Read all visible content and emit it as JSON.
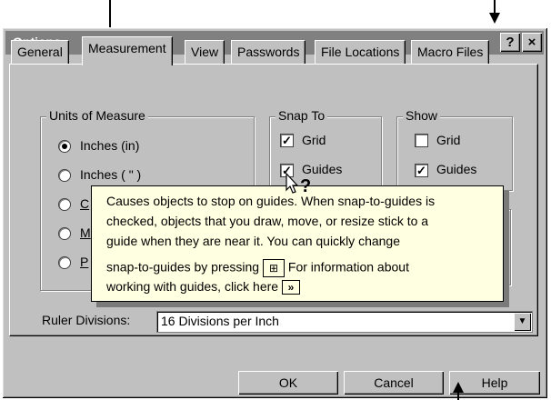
{
  "window": {
    "title": "Options",
    "help_btn": "?",
    "close_btn": "×"
  },
  "tabs": [
    {
      "label": "General",
      "active": false
    },
    {
      "label": "Measurement",
      "active": true
    },
    {
      "label": "View",
      "active": false
    },
    {
      "label": "Passwords",
      "active": false
    },
    {
      "label": "File Locations",
      "active": false
    },
    {
      "label": "Macro Files",
      "active": false
    }
  ],
  "units": {
    "label": "Units of Measure",
    "options": [
      "Inches (in)",
      "Inches ( \" )",
      "C",
      "M",
      "P"
    ],
    "selected_index": 0
  },
  "snap_to": {
    "label": "Snap To",
    "grid": "Grid",
    "guides": "Guides",
    "grid_checked": true,
    "guides_checked": true
  },
  "show": {
    "label": "Show",
    "grid": "Grid",
    "guides": "Guides",
    "grid_checked": false,
    "guides_checked": true
  },
  "tooltip": {
    "line1": "Causes objects to stop on guides. When snap-to-guides is",
    "line2": "checked, objects that you draw, move, or resize stick to a",
    "line3": "guide when they are near it. You can quickly change",
    "line4_pre": "snap-to-guides by pressing",
    "line4_post": "For information about",
    "line5": "working with guides, click here",
    "link_icon": "»"
  },
  "ruler": {
    "label": "Ruler Divisions:",
    "value": "16 Divisions per Inch"
  },
  "buttons": {
    "ok": "OK",
    "cancel": "Cancel",
    "help": "Help"
  }
}
